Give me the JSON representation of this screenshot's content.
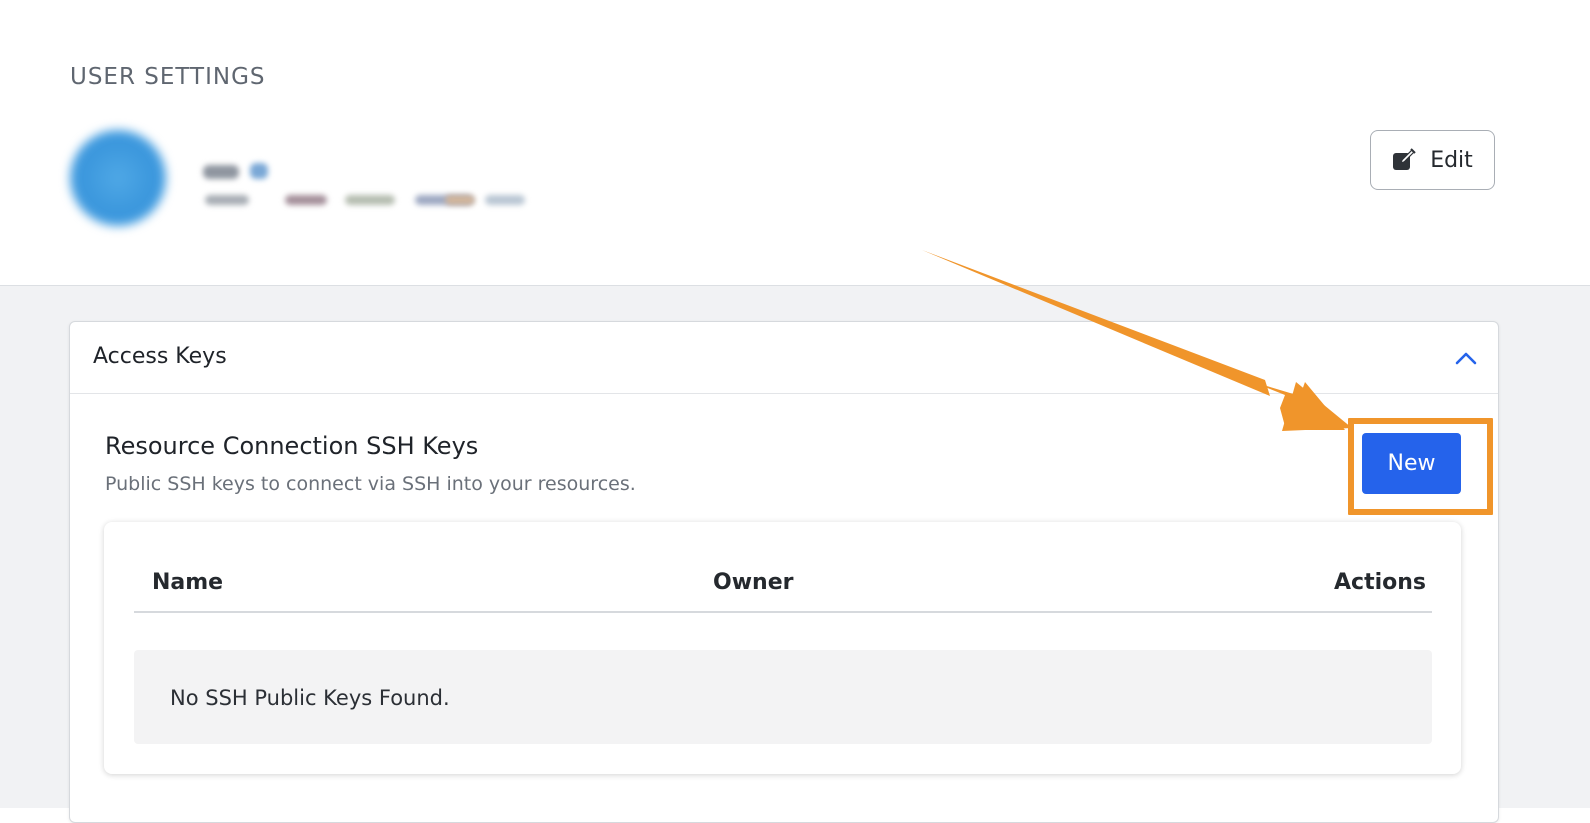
{
  "page": {
    "title": "USER SETTINGS"
  },
  "header": {
    "edit_label": "Edit"
  },
  "access_keys": {
    "title": "Access Keys",
    "section_title": "Resource Connection SSH Keys",
    "section_subtitle": "Public SSH keys to connect via SSH into your resources.",
    "new_label": "New",
    "table": {
      "columns": [
        "Name",
        "Owner",
        "Actions"
      ],
      "empty_message": "No SSH Public Keys Found."
    }
  },
  "colors": {
    "primary_button": "#2563eb",
    "annotation": "#f0952b",
    "collapse_chevron": "#2563eb"
  },
  "icons": {
    "edit": "edit-icon",
    "collapse": "chevron-up-icon",
    "avatar": "avatar"
  }
}
